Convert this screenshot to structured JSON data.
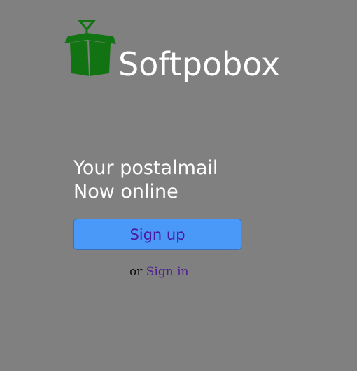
{
  "logo": {
    "icon": "open-box-icon",
    "text": "Softpobox",
    "icon_color": "#127312"
  },
  "hero": {
    "line1": "Your postalmail",
    "line2": "Now online"
  },
  "signup": {
    "label": "Sign up",
    "bg_color": "#4a99f8",
    "text_color": "#4a1a9c"
  },
  "signin": {
    "prefix": "or",
    "label": "Sign in",
    "link_color": "#4d1d8f"
  },
  "colors": {
    "background": "#808080",
    "text": "#ffffff"
  }
}
